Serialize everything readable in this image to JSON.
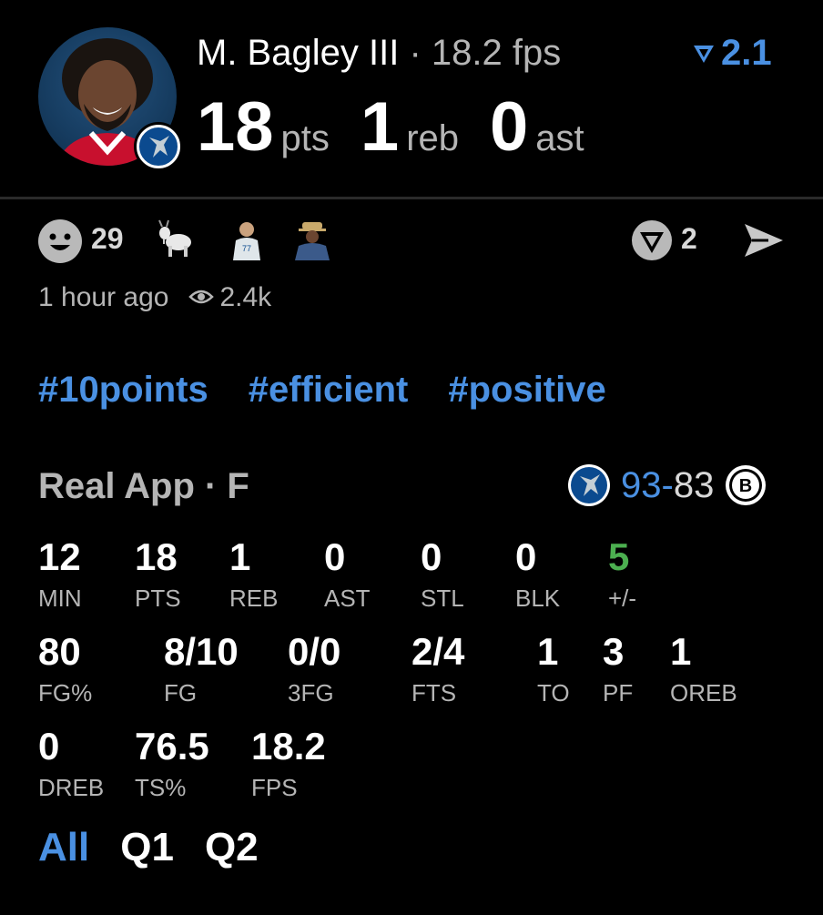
{
  "header": {
    "player_name": "M. Bagley III",
    "separator": "·",
    "fps_text": "18.2 fps",
    "rank_value": "2.1",
    "pts": "18",
    "pts_unit": "pts",
    "reb": "1",
    "reb_unit": "reb",
    "ast": "0",
    "ast_unit": "ast"
  },
  "reactions": {
    "smiley_count": "29",
    "emojis": [
      "goat-emoji",
      "player-emoji",
      "fan-emoji"
    ],
    "vote_count": "2"
  },
  "meta": {
    "time_ago": "1 hour ago",
    "views": "2.4k"
  },
  "tags": [
    "#10points",
    "#efficient",
    "#positive"
  ],
  "game": {
    "source": "Real App · F",
    "team_score": "93",
    "dash": "-",
    "opp_score": "83"
  },
  "stats": [
    {
      "value": "12",
      "label": "MIN"
    },
    {
      "value": "18",
      "label": "PTS"
    },
    {
      "value": "1",
      "label": "REB"
    },
    {
      "value": "0",
      "label": "AST"
    },
    {
      "value": "0",
      "label": "STL"
    },
    {
      "value": "0",
      "label": "BLK"
    },
    {
      "value": "5",
      "label": "+/-"
    },
    {
      "value": "80",
      "label": "FG%"
    },
    {
      "value": "8/10",
      "label": "FG"
    },
    {
      "value": "0/0",
      "label": "3FG"
    },
    {
      "value": "2/4",
      "label": "FTS"
    },
    {
      "value": "1",
      "label": "TO"
    },
    {
      "value": "3",
      "label": "PF"
    },
    {
      "value": "1",
      "label": "OREB"
    },
    {
      "value": "0",
      "label": "DREB"
    },
    {
      "value": "76.5",
      "label": "TS%"
    },
    {
      "value": "18.2",
      "label": "FPS"
    }
  ],
  "periods": [
    "All",
    "Q1",
    "Q2"
  ],
  "colors": {
    "accent": "#4a90e2",
    "positive": "#4caf50",
    "muted": "#b5b5b5",
    "background": "#000000"
  }
}
